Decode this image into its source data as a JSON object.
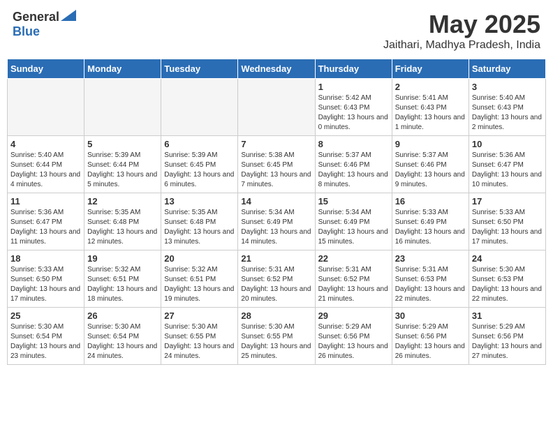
{
  "header": {
    "logo_general": "General",
    "logo_blue": "Blue",
    "month_title": "May 2025",
    "location": "Jaithari, Madhya Pradesh, India"
  },
  "days_of_week": [
    "Sunday",
    "Monday",
    "Tuesday",
    "Wednesday",
    "Thursday",
    "Friday",
    "Saturday"
  ],
  "weeks": [
    [
      {
        "day": "",
        "info": ""
      },
      {
        "day": "",
        "info": ""
      },
      {
        "day": "",
        "info": ""
      },
      {
        "day": "",
        "info": ""
      },
      {
        "day": "1",
        "info": "Sunrise: 5:42 AM\nSunset: 6:43 PM\nDaylight: 13 hours and 0 minutes."
      },
      {
        "day": "2",
        "info": "Sunrise: 5:41 AM\nSunset: 6:43 PM\nDaylight: 13 hours and 1 minute."
      },
      {
        "day": "3",
        "info": "Sunrise: 5:40 AM\nSunset: 6:43 PM\nDaylight: 13 hours and 2 minutes."
      }
    ],
    [
      {
        "day": "4",
        "info": "Sunrise: 5:40 AM\nSunset: 6:44 PM\nDaylight: 13 hours and 4 minutes."
      },
      {
        "day": "5",
        "info": "Sunrise: 5:39 AM\nSunset: 6:44 PM\nDaylight: 13 hours and 5 minutes."
      },
      {
        "day": "6",
        "info": "Sunrise: 5:39 AM\nSunset: 6:45 PM\nDaylight: 13 hours and 6 minutes."
      },
      {
        "day": "7",
        "info": "Sunrise: 5:38 AM\nSunset: 6:45 PM\nDaylight: 13 hours and 7 minutes."
      },
      {
        "day": "8",
        "info": "Sunrise: 5:37 AM\nSunset: 6:46 PM\nDaylight: 13 hours and 8 minutes."
      },
      {
        "day": "9",
        "info": "Sunrise: 5:37 AM\nSunset: 6:46 PM\nDaylight: 13 hours and 9 minutes."
      },
      {
        "day": "10",
        "info": "Sunrise: 5:36 AM\nSunset: 6:47 PM\nDaylight: 13 hours and 10 minutes."
      }
    ],
    [
      {
        "day": "11",
        "info": "Sunrise: 5:36 AM\nSunset: 6:47 PM\nDaylight: 13 hours and 11 minutes."
      },
      {
        "day": "12",
        "info": "Sunrise: 5:35 AM\nSunset: 6:48 PM\nDaylight: 13 hours and 12 minutes."
      },
      {
        "day": "13",
        "info": "Sunrise: 5:35 AM\nSunset: 6:48 PM\nDaylight: 13 hours and 13 minutes."
      },
      {
        "day": "14",
        "info": "Sunrise: 5:34 AM\nSunset: 6:49 PM\nDaylight: 13 hours and 14 minutes."
      },
      {
        "day": "15",
        "info": "Sunrise: 5:34 AM\nSunset: 6:49 PM\nDaylight: 13 hours and 15 minutes."
      },
      {
        "day": "16",
        "info": "Sunrise: 5:33 AM\nSunset: 6:49 PM\nDaylight: 13 hours and 16 minutes."
      },
      {
        "day": "17",
        "info": "Sunrise: 5:33 AM\nSunset: 6:50 PM\nDaylight: 13 hours and 17 minutes."
      }
    ],
    [
      {
        "day": "18",
        "info": "Sunrise: 5:33 AM\nSunset: 6:50 PM\nDaylight: 13 hours and 17 minutes."
      },
      {
        "day": "19",
        "info": "Sunrise: 5:32 AM\nSunset: 6:51 PM\nDaylight: 13 hours and 18 minutes."
      },
      {
        "day": "20",
        "info": "Sunrise: 5:32 AM\nSunset: 6:51 PM\nDaylight: 13 hours and 19 minutes."
      },
      {
        "day": "21",
        "info": "Sunrise: 5:31 AM\nSunset: 6:52 PM\nDaylight: 13 hours and 20 minutes."
      },
      {
        "day": "22",
        "info": "Sunrise: 5:31 AM\nSunset: 6:52 PM\nDaylight: 13 hours and 21 minutes."
      },
      {
        "day": "23",
        "info": "Sunrise: 5:31 AM\nSunset: 6:53 PM\nDaylight: 13 hours and 22 minutes."
      },
      {
        "day": "24",
        "info": "Sunrise: 5:30 AM\nSunset: 6:53 PM\nDaylight: 13 hours and 22 minutes."
      }
    ],
    [
      {
        "day": "25",
        "info": "Sunrise: 5:30 AM\nSunset: 6:54 PM\nDaylight: 13 hours and 23 minutes."
      },
      {
        "day": "26",
        "info": "Sunrise: 5:30 AM\nSunset: 6:54 PM\nDaylight: 13 hours and 24 minutes."
      },
      {
        "day": "27",
        "info": "Sunrise: 5:30 AM\nSunset: 6:55 PM\nDaylight: 13 hours and 24 minutes."
      },
      {
        "day": "28",
        "info": "Sunrise: 5:30 AM\nSunset: 6:55 PM\nDaylight: 13 hours and 25 minutes."
      },
      {
        "day": "29",
        "info": "Sunrise: 5:29 AM\nSunset: 6:56 PM\nDaylight: 13 hours and 26 minutes."
      },
      {
        "day": "30",
        "info": "Sunrise: 5:29 AM\nSunset: 6:56 PM\nDaylight: 13 hours and 26 minutes."
      },
      {
        "day": "31",
        "info": "Sunrise: 5:29 AM\nSunset: 6:56 PM\nDaylight: 13 hours and 27 minutes."
      }
    ]
  ]
}
